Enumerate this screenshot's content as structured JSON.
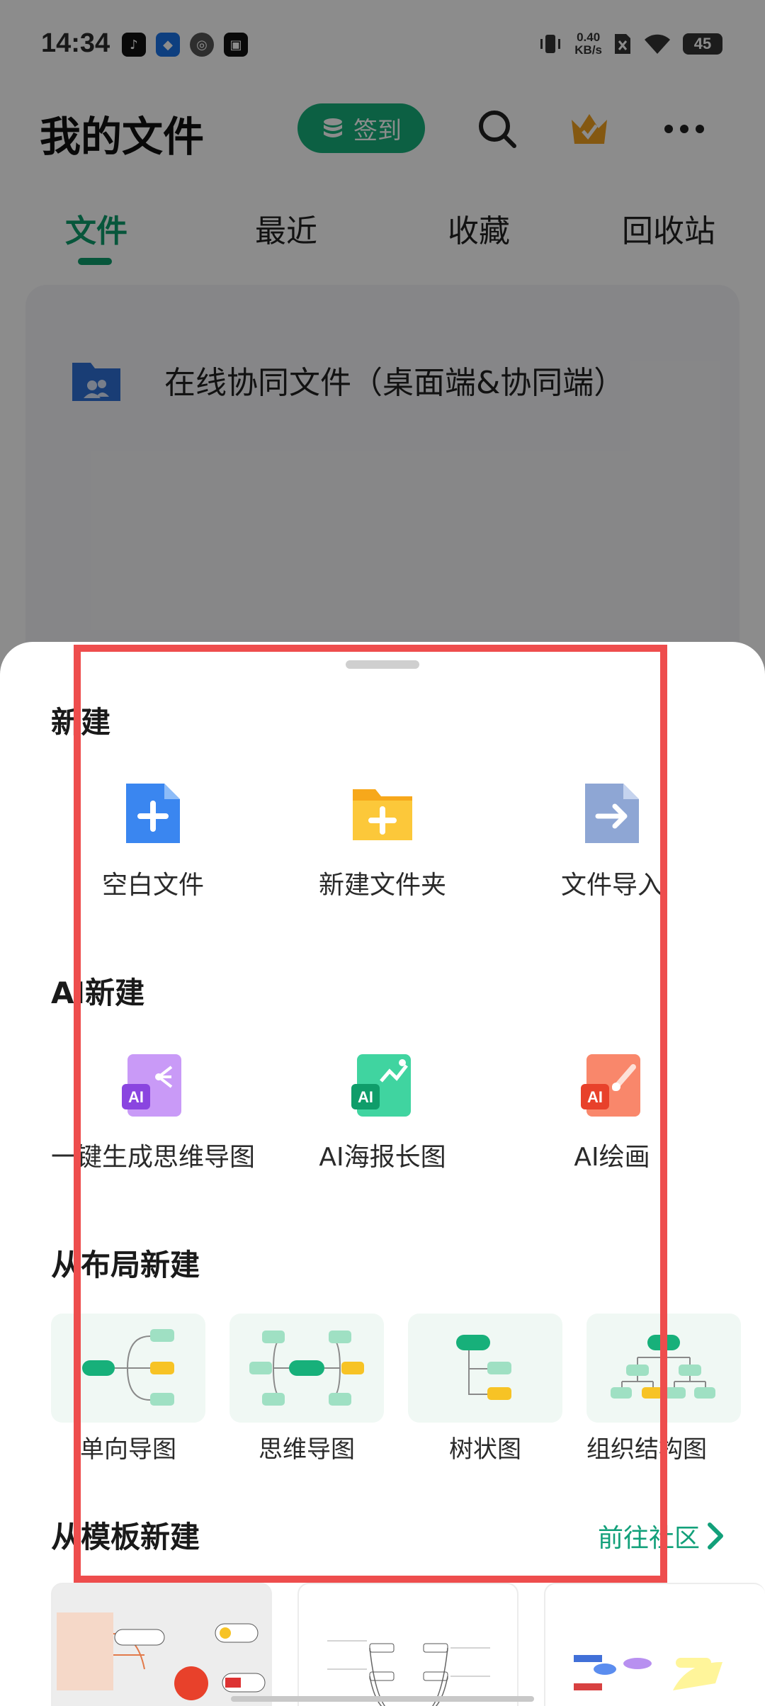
{
  "status_bar": {
    "time": "14:34",
    "network_speed_value": "0.40",
    "network_speed_unit": "KB/s",
    "battery": "45"
  },
  "header": {
    "title": "我的文件",
    "signin_label": "签到"
  },
  "tabs": [
    {
      "label": "文件",
      "active": true
    },
    {
      "label": "最近",
      "active": false
    },
    {
      "label": "收藏",
      "active": false
    },
    {
      "label": "回收站",
      "active": false
    }
  ],
  "files": {
    "folder_label": "在线协同文件（桌面端&协同端）"
  },
  "sheet": {
    "new_section": {
      "title": "新建",
      "items": [
        {
          "label": "空白文件",
          "icon": "blank-file-icon",
          "color": "#3a86f0"
        },
        {
          "label": "新建文件夹",
          "icon": "new-folder-icon",
          "color": "#f7b52a"
        },
        {
          "label": "文件导入",
          "icon": "file-import-icon",
          "color": "#8ea6d4"
        }
      ]
    },
    "ai_section": {
      "title": "AI新建",
      "items": [
        {
          "label": "一键生成思维导图",
          "icon": "ai-mindmap-icon",
          "color": "#a56cf0"
        },
        {
          "label": "AI海报长图",
          "icon": "ai-poster-icon",
          "color": "#27c28a"
        },
        {
          "label": "AI绘画",
          "icon": "ai-painting-icon",
          "color": "#f25d45"
        }
      ]
    },
    "layout_section": {
      "title": "从布局新建",
      "items": [
        {
          "label": "单向导图",
          "icon": "one-way-map-icon"
        },
        {
          "label": "思维导图",
          "icon": "mind-map-icon"
        },
        {
          "label": "树状图",
          "icon": "tree-chart-icon"
        },
        {
          "label": "组织结构图",
          "icon": "org-chart-icon"
        }
      ]
    },
    "template_section": {
      "title": "从模板新建",
      "goto_label": "前往社区"
    }
  },
  "colors": {
    "brand_green": "#16b07a",
    "highlight_red": "#ee4d4d"
  }
}
